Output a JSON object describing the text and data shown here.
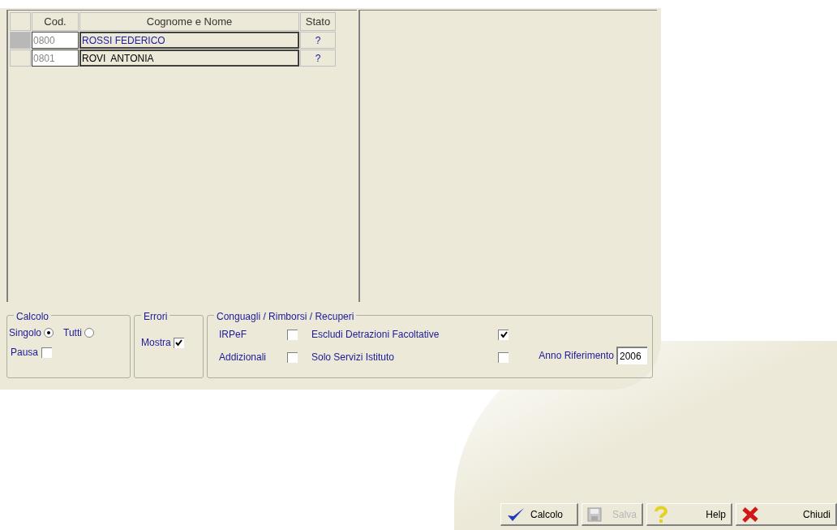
{
  "table": {
    "columns": [
      "Cod.",
      "Cognome e Nome",
      "Stato"
    ],
    "rows": [
      {
        "code": "0800",
        "name": "ROSSI FEDERICO",
        "stato": "?",
        "selected": true
      },
      {
        "code": "0801",
        "name": "ROVI  ANTONIA",
        "stato": "?",
        "selected": false
      }
    ]
  },
  "calcolo": {
    "title": "Calcolo",
    "modes": [
      {
        "label": "Singolo",
        "selected": true
      },
      {
        "label": "Tutti",
        "selected": false
      }
    ],
    "pausa": {
      "label": "Pausa",
      "checked": false
    }
  },
  "errori": {
    "title": "Errori",
    "mostra": {
      "label": "Mostra",
      "checked": true
    }
  },
  "conguagli": {
    "title": "Conguagli / Rimborsi / Recuperi",
    "options": [
      {
        "label": "IRPeF",
        "checked": false
      },
      {
        "label": "Escludi Detrazioni Facoltative",
        "checked": true
      },
      {
        "label": "Addizionali",
        "checked": false
      },
      {
        "label": "Solo Servizi Istituto",
        "checked": false
      }
    ],
    "anno": {
      "label": "Anno Riferimento",
      "value": "2006"
    }
  },
  "buttons": [
    {
      "kind": "calc",
      "label": "Calcolo",
      "disabled": false
    },
    {
      "kind": "save",
      "label": "Salva",
      "disabled": true
    },
    {
      "kind": "help",
      "label": "Help",
      "disabled": false
    },
    {
      "kind": "close",
      "label": "Chiudi",
      "disabled": false
    }
  ]
}
